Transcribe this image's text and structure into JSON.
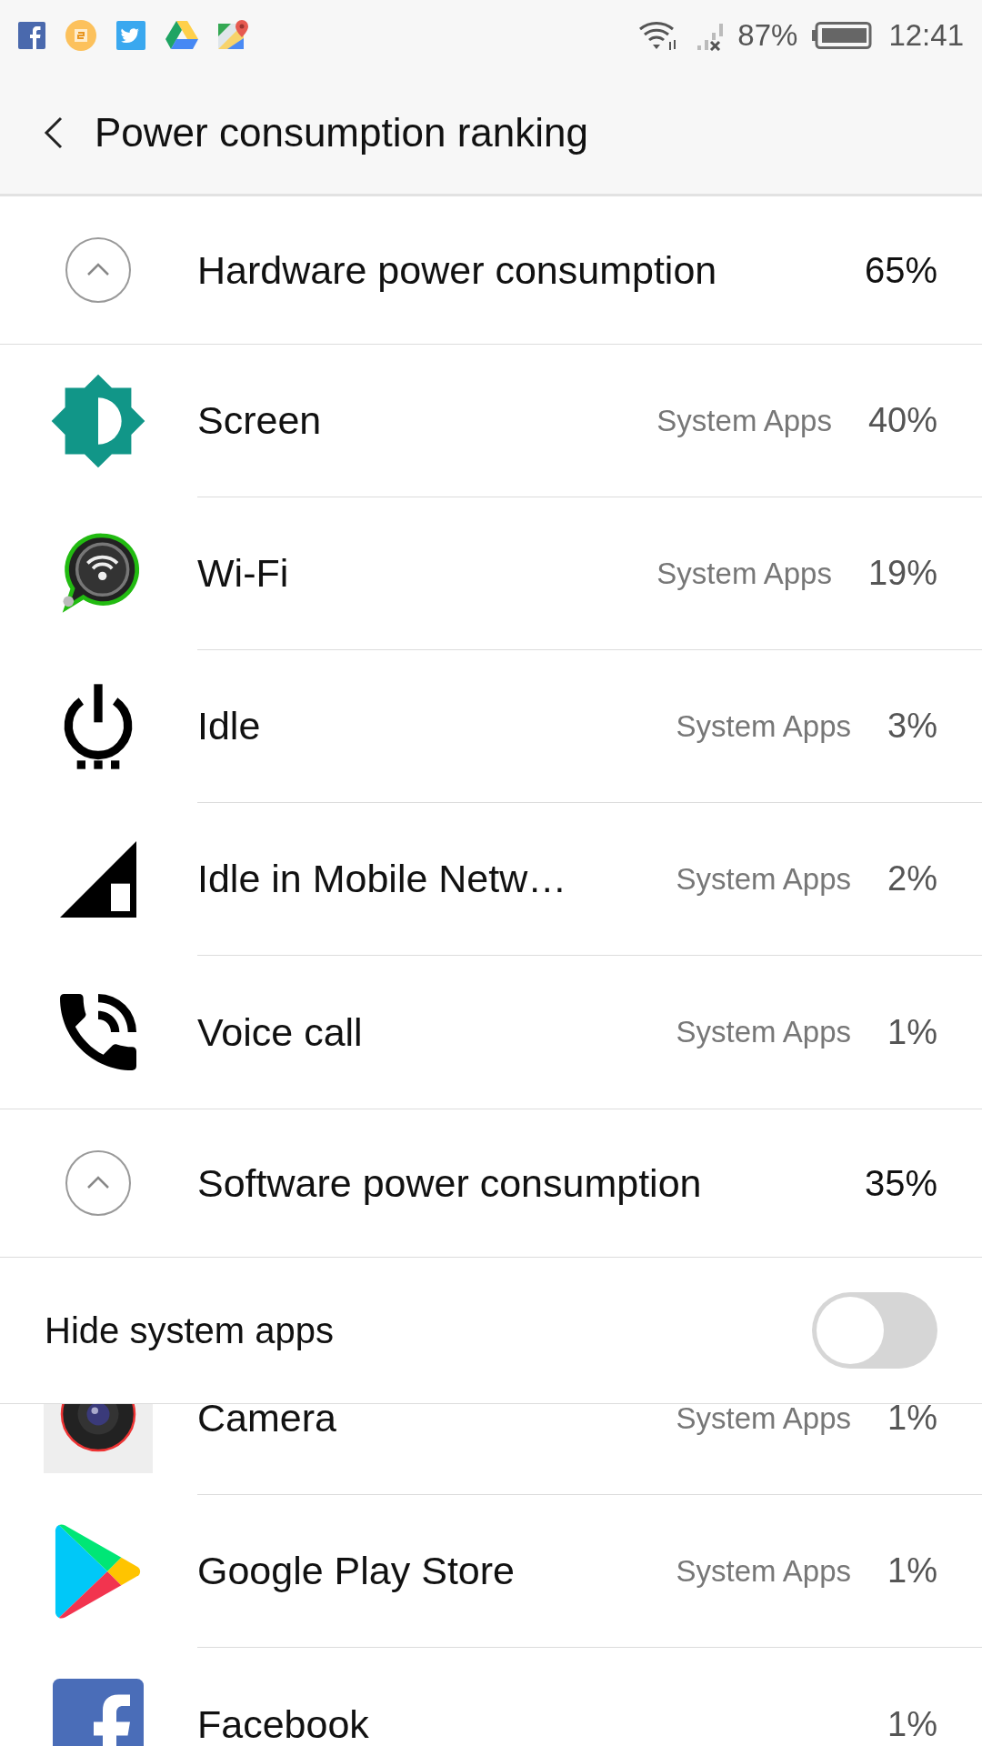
{
  "status_bar": {
    "battery": "87%",
    "time": "12:41"
  },
  "header": {
    "title": "Power consumption ranking"
  },
  "hardware": {
    "title": "Hardware power consumption",
    "percent": "65%",
    "expanded": true,
    "rows": [
      {
        "name": "Screen",
        "category": "System Apps",
        "percent": "40%"
      },
      {
        "name": "Wi-Fi",
        "category": "System Apps",
        "percent": "19%"
      },
      {
        "name": "Idle",
        "category": "System Apps",
        "percent": "3%"
      },
      {
        "name": "Idle in Mobile Netw…",
        "category": "System Apps",
        "percent": "2%"
      },
      {
        "name": "Voice call",
        "category": "System Apps",
        "percent": "1%"
      }
    ]
  },
  "software": {
    "title": "Software power consumption",
    "percent": "35%",
    "expanded": true,
    "hide_system_apps": {
      "label": "Hide system apps",
      "on": false
    },
    "rows": [
      {
        "name": "Camera",
        "category": "System Apps",
        "percent": "1%"
      },
      {
        "name": "Google Play Store",
        "category": "System Apps",
        "percent": "1%"
      },
      {
        "name": "Facebook",
        "percent": "1%"
      }
    ]
  }
}
